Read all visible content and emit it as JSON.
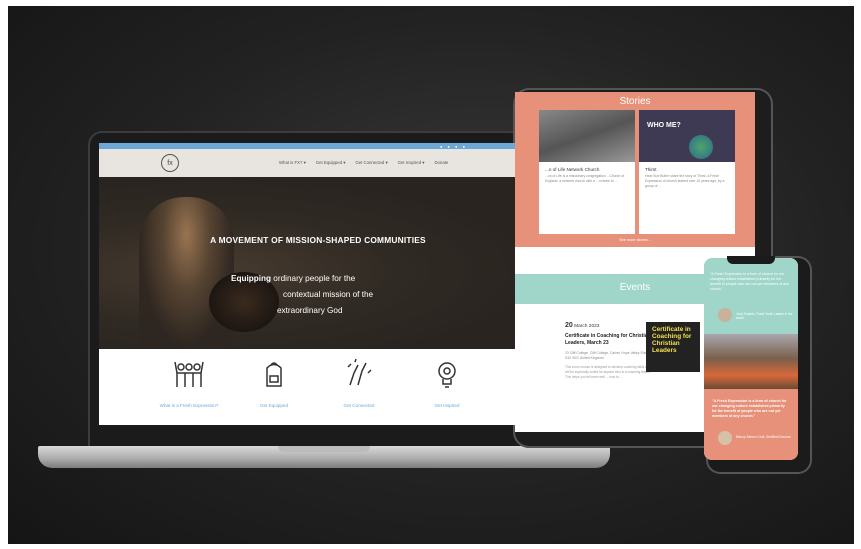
{
  "laptop": {
    "logo": "fx",
    "nav": [
      "What is FX? ▾",
      "Get Equipped ▾",
      "Get Connected ▾",
      "Get Inspired ▾",
      "Donate"
    ],
    "hero_title": "A MOVEMENT OF MISSION-SHAPED COMMUNITIES",
    "hero_bold": "Equipping",
    "hero_line1": " ordinary people for the",
    "hero_line2": "contextual mission of the",
    "hero_line3": "extraordinary God",
    "icons": [
      {
        "icon": "people-raising-hands-icon",
        "label": "What is a Fresh Expression?"
      },
      {
        "icon": "backpack-icon",
        "label": "Get Equipped"
      },
      {
        "icon": "high-five-icon",
        "label": "Get Connected"
      },
      {
        "icon": "lightbulb-icon",
        "label": "Get Inspired"
      }
    ]
  },
  "tablet": {
    "stories_title": "Stories",
    "card1_title": "...n of Life Network Church",
    "card1_text": "...un of Life is a missionary congregation ...Church of England. a network church with a ...m team to ...",
    "card2_badge": "WHO ME?",
    "card2_title": "Thirst",
    "card2_text": "Hear Sue Butler share the story of Thirst, a Fresh Expression of church started over 10 years ago, by a group of ...",
    "see_more": "See more stories...",
    "events_title": "Events",
    "event_day": "20",
    "event_date": "March 2023",
    "event_name": "Certificate in Coaching for Christian Leaders, March 23",
    "event_addr": "23 Cliff College, Cliff College, Calver, Hope Valley Sheffield S32 3XG United Kingdom",
    "event_desc": "This zoom course is designed to develop coaching skills and will be especially suited for anyone who is a coaching leader. This helps you tell team well ... how to ...",
    "cert_text": "Certificate in Coaching for Christian Leaders"
  },
  "phone": {
    "quote1": "\"A Fresh Expression is a form of church for our changing culture established primarily for the benefit of people who are not yet members of any church.\"",
    "person1": "Josh Roberts, Rural Youth Leader in the south",
    "quote2": "\"A Fresh Expression is a form of church for our changing culture established primarily for the benefit of people who are not yet members of any church.\"",
    "person2": "Bishop Steven Croft, Sheffield Diocese"
  },
  "colors": {
    "accent_blue": "#6da7d6",
    "salmon": "#e8917a",
    "mint": "#9fd6c9",
    "cert_yellow": "#f2e04a"
  }
}
